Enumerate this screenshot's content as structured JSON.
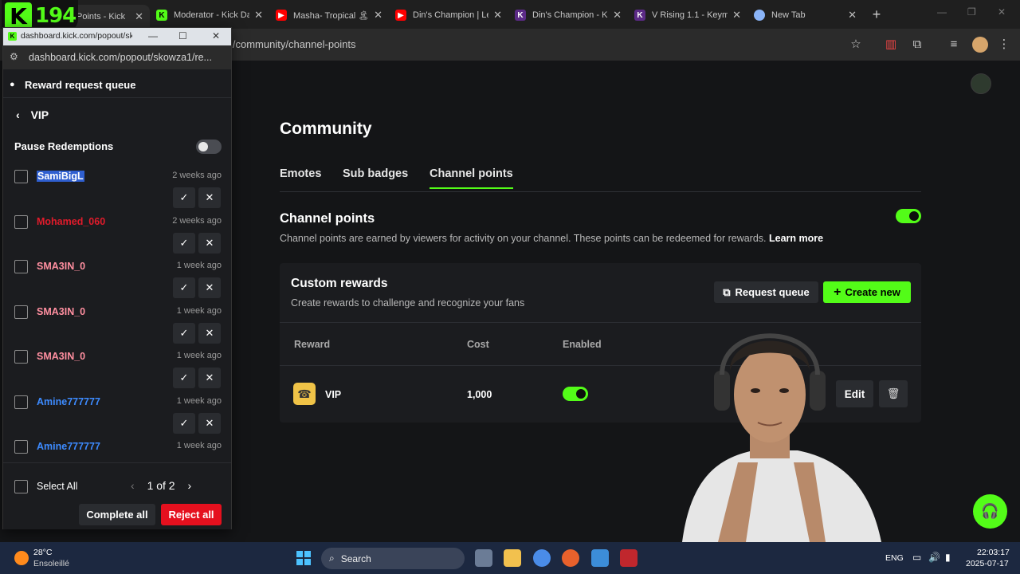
{
  "browser": {
    "tabs": [
      {
        "label": "Points - Kick",
        "active": true
      },
      {
        "label": "Moderator - Kick Da",
        "active": false
      },
      {
        "label": "Masha- Tropical 🏝",
        "active": false
      },
      {
        "label": "Din's Champion | Le",
        "active": false
      },
      {
        "label": "Din's Champion - K",
        "active": false
      },
      {
        "label": "V Rising 1.1 - Keyma",
        "active": false
      },
      {
        "label": "New Tab",
        "active": false
      }
    ],
    "new_tab_symbol": "+",
    "address_partial": "l/community/channel-points",
    "overlay_logo": {
      "letter": "K",
      "number": "194"
    }
  },
  "popout": {
    "window_title": "dashboard.kick.com/popout/sk",
    "url": "dashboard.kick.com/popout/skowza1/re...",
    "header_title": "Reward request queue",
    "back_label": "VIP",
    "pause_label": "Pause Redemptions",
    "pause_enabled": false,
    "requests": [
      {
        "name": "SamiBigL",
        "time": "2 weeks ago",
        "color": "#4b7bff",
        "selected_text": true
      },
      {
        "name": "Mohamed_060",
        "time": "2 weeks ago",
        "color": "#e11b2b"
      },
      {
        "name": "SMA3IN_0",
        "time": "1 week ago",
        "color": "#ff8fa0"
      },
      {
        "name": "SMA3IN_0",
        "time": "1 week ago",
        "color": "#ff8fa0"
      },
      {
        "name": "SMA3IN_0",
        "time": "1 week ago",
        "color": "#ff8fa0"
      },
      {
        "name": "Amine777777",
        "time": "1 week ago",
        "color": "#3d8bff"
      },
      {
        "name": "Amine777777",
        "time": "1 week ago",
        "color": "#3d8bff"
      }
    ],
    "select_all_label": "Select All",
    "page_indicator": "1 of 2",
    "complete_all_label": "Complete all",
    "reject_all_label": "Reject all"
  },
  "main": {
    "page_title": "Community",
    "tabs": [
      {
        "label": "Emotes",
        "active": false
      },
      {
        "label": "Sub badges",
        "active": false
      },
      {
        "label": "Channel points",
        "active": true
      }
    ],
    "channel_points": {
      "title": "Channel points",
      "description": "Channel points are earned by viewers for activity on your channel. These points can be redeemed for rewards.",
      "learn_more": "Learn more",
      "enabled": true
    },
    "custom_rewards": {
      "title": "Custom rewards",
      "subtitle": "Create rewards to challenge and recognize your fans",
      "request_queue_label": "Request queue",
      "create_new_label": "Create new",
      "columns": [
        "Reward",
        "Cost",
        "Enabled"
      ],
      "rows": [
        {
          "name": "VIP",
          "cost": "1,000",
          "enabled": true,
          "edit_label": "Edit"
        }
      ]
    }
  },
  "taskbar": {
    "weather_temp": "28°C",
    "weather_desc": "Ensoleillé",
    "search_label": "Search",
    "language": "ENG",
    "time": "22:03:17",
    "date": "2025-07-17"
  },
  "colors": {
    "accent": "#53fc18",
    "danger": "#e5101e",
    "background": "#141517",
    "card": "#1b1c1f"
  }
}
